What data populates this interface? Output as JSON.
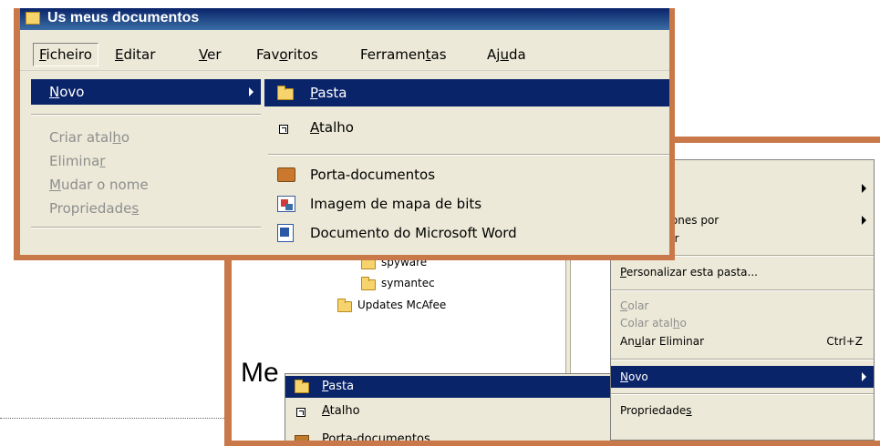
{
  "window": {
    "title": "Us meus documentos"
  },
  "menubar": {
    "items": [
      {
        "pre": "",
        "key": "F",
        "post": "icheiro"
      },
      {
        "pre": "",
        "key": "E",
        "post": "ditar"
      },
      {
        "pre": "",
        "key": "V",
        "post": "er"
      },
      {
        "pre": "Fav",
        "key": "o",
        "post": "ritos"
      },
      {
        "pre": "Ferramen",
        "key": "t",
        "post": "as"
      },
      {
        "pre": "Aj",
        "key": "u",
        "post": "da"
      }
    ]
  },
  "file_menu": {
    "items": [
      {
        "pre": "",
        "key": "N",
        "post": "ovo"
      },
      {
        "pre": "Criar atal",
        "key": "h",
        "post": "o"
      },
      {
        "pre": "Elimina",
        "key": "r",
        "post": ""
      },
      {
        "pre": "",
        "key": "M",
        "post": "udar o nome"
      },
      {
        "pre": "Propriedade",
        "key": "s",
        "post": ""
      }
    ]
  },
  "new_submenu": {
    "items": [
      {
        "pre": "",
        "key": "P",
        "post": "asta",
        "icon": "folder-icon"
      },
      {
        "pre": "",
        "key": "A",
        "post": "talho",
        "icon": "shortcut-icon"
      },
      {
        "pre": "Porta-documentos",
        "key": "",
        "post": "",
        "icon": "briefcase-icon"
      },
      {
        "pre": "Imagem de mapa de bits",
        "key": "",
        "post": "",
        "icon": "bitmap-image-icon"
      },
      {
        "pre": "Documento do Microsoft Word",
        "key": "",
        "post": "",
        "icon": "word-document-icon"
      }
    ]
  },
  "folder_tree": {
    "items": [
      "spyware",
      "symantec",
      "Updates McAfee"
    ]
  },
  "background_text": "Me",
  "context_menu": {
    "items": [
      {
        "pre": "",
        "key": "",
        "post": ""
      },
      {
        "pre": "",
        "key": "",
        "post": "ícones por"
      },
      {
        "pre": "",
        "key": "",
        "post": "zar"
      },
      {
        "pre": "",
        "key": "P",
        "post": "ersonalizar esta pasta..."
      },
      {
        "pre": "",
        "key": "C",
        "post": "olar"
      },
      {
        "pre": "Colar atal",
        "key": "h",
        "post": "o"
      },
      {
        "pre": "An",
        "key": "u",
        "post": "lar Eliminar",
        "shortcut": "Ctrl+Z"
      },
      {
        "pre": "",
        "key": "N",
        "post": "ovo"
      },
      {
        "pre": "Propriedade",
        "key": "s",
        "post": ""
      }
    ]
  },
  "small_new_submenu": {
    "items": [
      {
        "pre": "",
        "key": "P",
        "post": "asta"
      },
      {
        "pre": "",
        "key": "A",
        "post": "talho"
      },
      {
        "pre": "Porta-documentos",
        "key": "",
        "post": ""
      }
    ]
  }
}
